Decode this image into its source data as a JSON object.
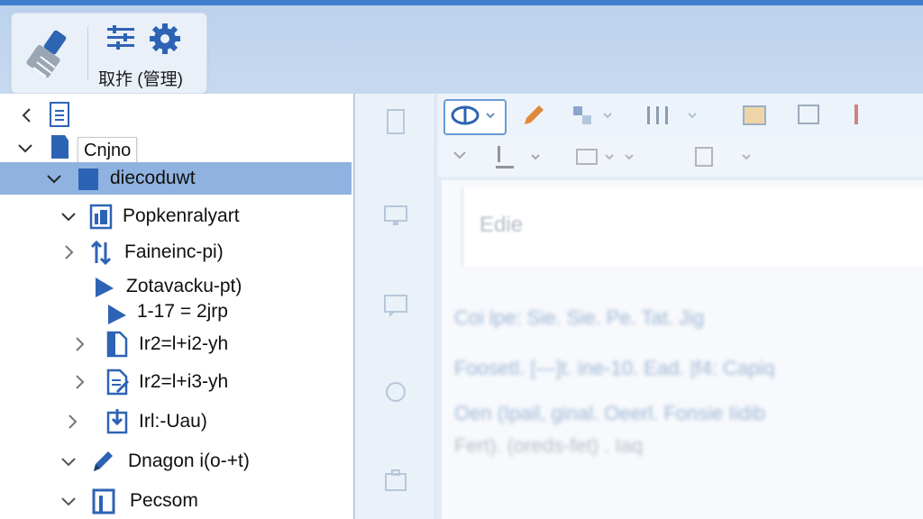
{
  "ribbon": {
    "group_label": "取拃 (管理)",
    "icons": [
      "brush-icon",
      "list-settings-icon",
      "gear-icon"
    ]
  },
  "tree": {
    "back_icon": "chevron-left-icon",
    "doc_icon": "document-icon",
    "tooltip": "Cnjno",
    "items": [
      {
        "label": "diecoduwt"
      },
      {
        "label": "Popkenralyart"
      },
      {
        "label": "Faineinc-pi)"
      },
      {
        "label": "Zotavacku-pt)"
      },
      {
        "label": "1-17 = 2jrp"
      },
      {
        "label": "Ir2=l+i2-yh"
      },
      {
        "label": "Ir2=l+i3-yh"
      },
      {
        "label": "Irl:-Uau)"
      },
      {
        "label": "Dnagon i(o-+t)"
      },
      {
        "label": "Pecsom"
      }
    ]
  },
  "editor": {
    "placeholder": "Edie",
    "lines": [
      "Coi   lpe:   Sie.   Sie.   Pe.   Tat.   Jig",
      "Foosetl.  [---]t.  ine-10.  Ead.  |f4: Capiq",
      "Oen  (Ipail,  ginal.   Oeerl.   Fonsie  Iidib",
      "Fert).  (oreds-fet)  .  Iaq"
    ]
  },
  "colors": {
    "accent": "#3f7fcf",
    "selection": "#8fb2e0",
    "icon_blue": "#2d63b5"
  }
}
